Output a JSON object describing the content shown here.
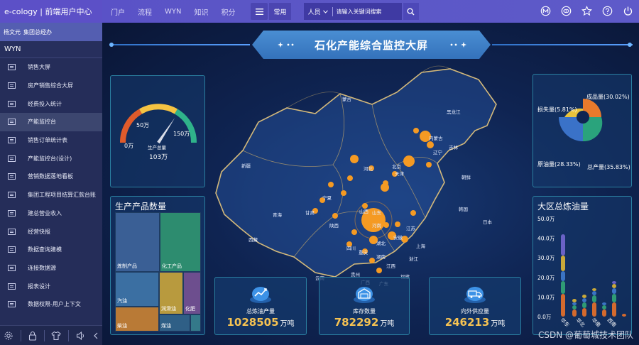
{
  "header": {
    "brand": "e-cology | 前端用户中心",
    "nav": [
      "门户",
      "流程",
      "WYN",
      "知识",
      "积分"
    ],
    "common_label": "常用",
    "search": {
      "scope": "人员",
      "placeholder": "请输入关键词搜索"
    }
  },
  "sidebar": {
    "user": "杨文元",
    "org": "集团总经办",
    "section": "WYN",
    "items": [
      {
        "label": "销售大屏",
        "active": false
      },
      {
        "label": "房产销售综合大屏",
        "active": false
      },
      {
        "label": "经费投入统计",
        "active": false
      },
      {
        "label": "产能监控台",
        "active": true
      },
      {
        "label": "销售订单统计表",
        "active": false
      },
      {
        "label": "产能监控台(设计)",
        "active": false
      },
      {
        "label": "营销数据落地看板",
        "active": false
      },
      {
        "label": "集团工程项目结算汇款台账",
        "active": false
      },
      {
        "label": "建总营业收入",
        "active": false
      },
      {
        "label": "经营快报",
        "active": false
      },
      {
        "label": "数据查询建模",
        "active": false
      },
      {
        "label": "连接数据源",
        "active": false
      },
      {
        "label": "报表设计",
        "active": false
      },
      {
        "label": "数据权限-用户上下文",
        "active": false
      }
    ]
  },
  "dashboard": {
    "title": "石化产能综合监控大屏",
    "gauge": {
      "ticks": [
        "0万",
        "50万",
        "150万"
      ],
      "label": "生产总量",
      "value": "103万",
      "max": 150,
      "current": 103
    },
    "treemap": {
      "title": "生产产品数量",
      "tiles": [
        "炼制产品",
        "化工产品",
        "汽油",
        "润滑油",
        "化肥",
        "柴油",
        "煤油"
      ]
    },
    "ring": {
      "labels": [
        "成品量(30.02%)",
        "损失量(5.81%)",
        "原油量(28.33%)",
        "总产量(35.83%)"
      ]
    },
    "bars": {
      "title": "大区总炼油量",
      "yticks": [
        "50.0万",
        "40.0万",
        "30.0万",
        "20.0万",
        "10.0万",
        "0.0万"
      ],
      "xlabels": [
        "华东",
        "华北",
        "华南",
        "西南"
      ]
    },
    "stats": [
      {
        "label": "总炼油产量",
        "value": "1028505",
        "unit": "万吨"
      },
      {
        "label": "库存数量",
        "value": "782292",
        "unit": "万吨"
      },
      {
        "label": "向外供应量",
        "value": "246213",
        "unit": "万吨"
      }
    ],
    "map_labels": [
      "蒙古",
      "黑龙江",
      "吉林",
      "辽宁",
      "内蒙古",
      "北京",
      "天津",
      "河北",
      "山西",
      "山东",
      "河南",
      "宁夏",
      "甘肃",
      "陕西",
      "青海",
      "新疆",
      "西藏",
      "四川",
      "重庆",
      "湖北",
      "湖南",
      "安徽",
      "江苏",
      "上海",
      "浙江",
      "江西",
      "福建",
      "贵州",
      "云南",
      "广西",
      "广东",
      "朝鲜",
      "韩国",
      "日本"
    ]
  },
  "watermark": "CSDN @葡萄城技术团队",
  "colors": {
    "accent": "#f59a23",
    "topbar": "#5b56c6",
    "sidebar": "#252d59",
    "title_bar": "#3a7cc6"
  }
}
